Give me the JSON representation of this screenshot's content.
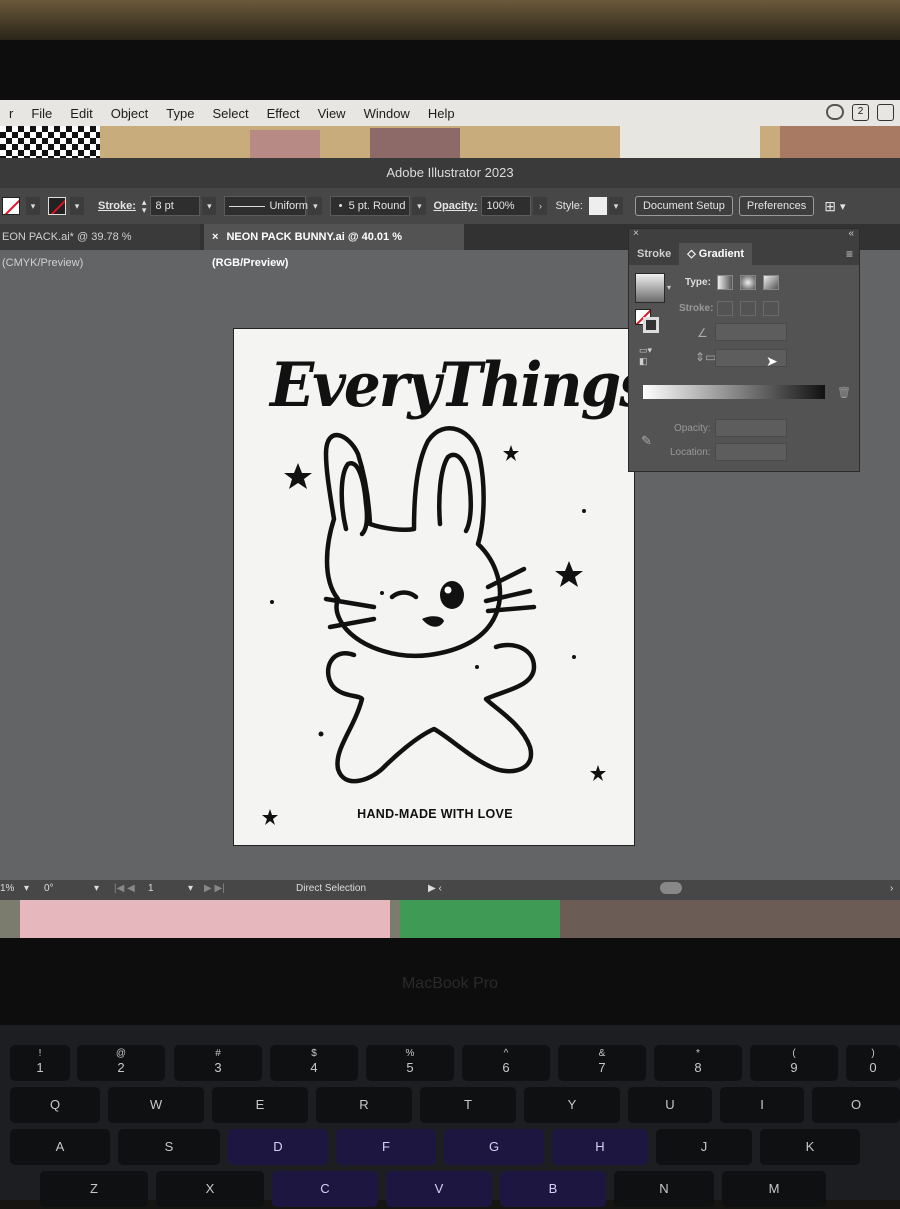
{
  "menubar": {
    "items": [
      "r",
      "File",
      "Edit",
      "Object",
      "Type",
      "Select",
      "Effect",
      "View",
      "Window",
      "Help"
    ],
    "badge": "2"
  },
  "window": {
    "title": "Adobe Illustrator 2023"
  },
  "control_bar": {
    "stroke_label": "Stroke:",
    "stroke_weight": "8 pt",
    "profile": "Uniform",
    "brush": "5 pt. Round",
    "opacity_label": "Opacity:",
    "opacity_value": "100%",
    "style_label": "Style:",
    "document_setup": "Document Setup",
    "preferences": "Preferences"
  },
  "tabs": [
    {
      "label": "EON PACK.ai* @ 39.78 % (CMYK/Preview)"
    },
    {
      "close": "×",
      "label": "NEON PACK BUNNY.ai @ 40.01 % (RGB/Preview)"
    }
  ],
  "artboard": {
    "title": "EveryThings",
    "footer": "HAND-MADE WITH LOVE"
  },
  "gradient_panel": {
    "close": "×",
    "collapse": "«",
    "tab_stroke": "Stroke",
    "tab_gradient": "Gradient",
    "tab_gradient_arrow": "◇",
    "menu": "≡",
    "type_label": "Type:",
    "stroke_label": "Stroke:",
    "opacity_label": "Opacity:",
    "location_label": "Location:"
  },
  "status_bar": {
    "zoom": "1%",
    "rotation": "0°",
    "artboard": "1",
    "tool": "Direct Selection"
  },
  "laptop": {
    "brand": "MacBook Pro"
  },
  "keyboard": {
    "row_numbers": [
      {
        "sym": "!",
        "main": "1"
      },
      {
        "sym": "@",
        "main": "2"
      },
      {
        "sym": "#",
        "main": "3"
      },
      {
        "sym": "$",
        "main": "4"
      },
      {
        "sym": "%",
        "main": "5"
      },
      {
        "sym": "^",
        "main": "6"
      },
      {
        "sym": "&",
        "main": "7"
      },
      {
        "sym": "*",
        "main": "8"
      },
      {
        "sym": "(",
        "main": "9"
      },
      {
        "sym": ")",
        "main": "0"
      }
    ],
    "row_q": [
      "Q",
      "W",
      "E",
      "R",
      "T",
      "Y",
      "U",
      "I",
      "O"
    ],
    "row_a": [
      "A",
      "S",
      "D",
      "F",
      "G",
      "H",
      "J",
      "K"
    ],
    "row_z": [
      "Z",
      "X",
      "C",
      "V",
      "B",
      "N",
      "M"
    ]
  }
}
